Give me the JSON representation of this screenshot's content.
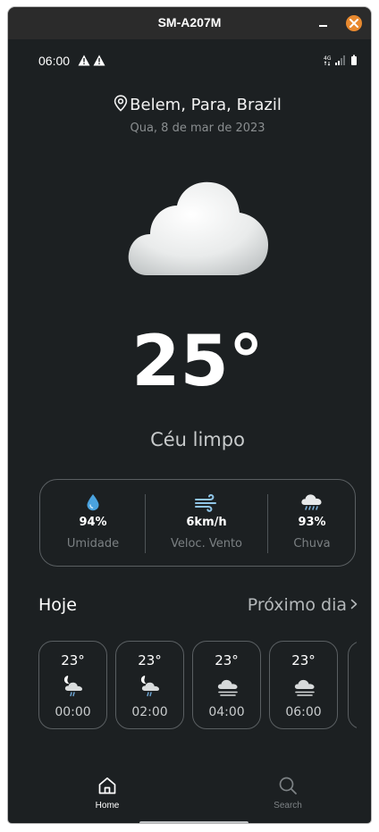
{
  "window": {
    "title": "SM-A207M"
  },
  "status_bar": {
    "time": "06:00",
    "network_label": "4G"
  },
  "location": {
    "city": "Belem, Para, Brazil",
    "date": "Qua, 8 de mar de 2023"
  },
  "current": {
    "temperature": "25°",
    "condition": "Céu limpo",
    "icon": "cloud-icon"
  },
  "stats": [
    {
      "value": "94%",
      "label": "Umidade",
      "icon": "water-drop-icon"
    },
    {
      "value": "6km/h",
      "label": "Veloc. Vento",
      "icon": "wind-icon"
    },
    {
      "value": "93%",
      "label": "Chuva",
      "icon": "rain-cloud-icon"
    }
  ],
  "forecast": {
    "today_label": "Hoje",
    "next_label": "Próximo dia",
    "hours": [
      {
        "temp": "23°",
        "time": "00:00",
        "icon": "night-rain-icon"
      },
      {
        "temp": "23°",
        "time": "02:00",
        "icon": "night-rain-icon"
      },
      {
        "temp": "23°",
        "time": "04:00",
        "icon": "fog-cloud-icon"
      },
      {
        "temp": "23°",
        "time": "06:00",
        "icon": "fog-cloud-icon"
      }
    ]
  },
  "nav": {
    "home_label": "Home",
    "search_label": "Search",
    "active_color": "#ffffff",
    "inactive_color": "#7d8285"
  },
  "colors": {
    "background": "#1c2022",
    "accent_close": "#e8892f",
    "drop": "#4aa3df",
    "wind": "#8fc4e6"
  }
}
